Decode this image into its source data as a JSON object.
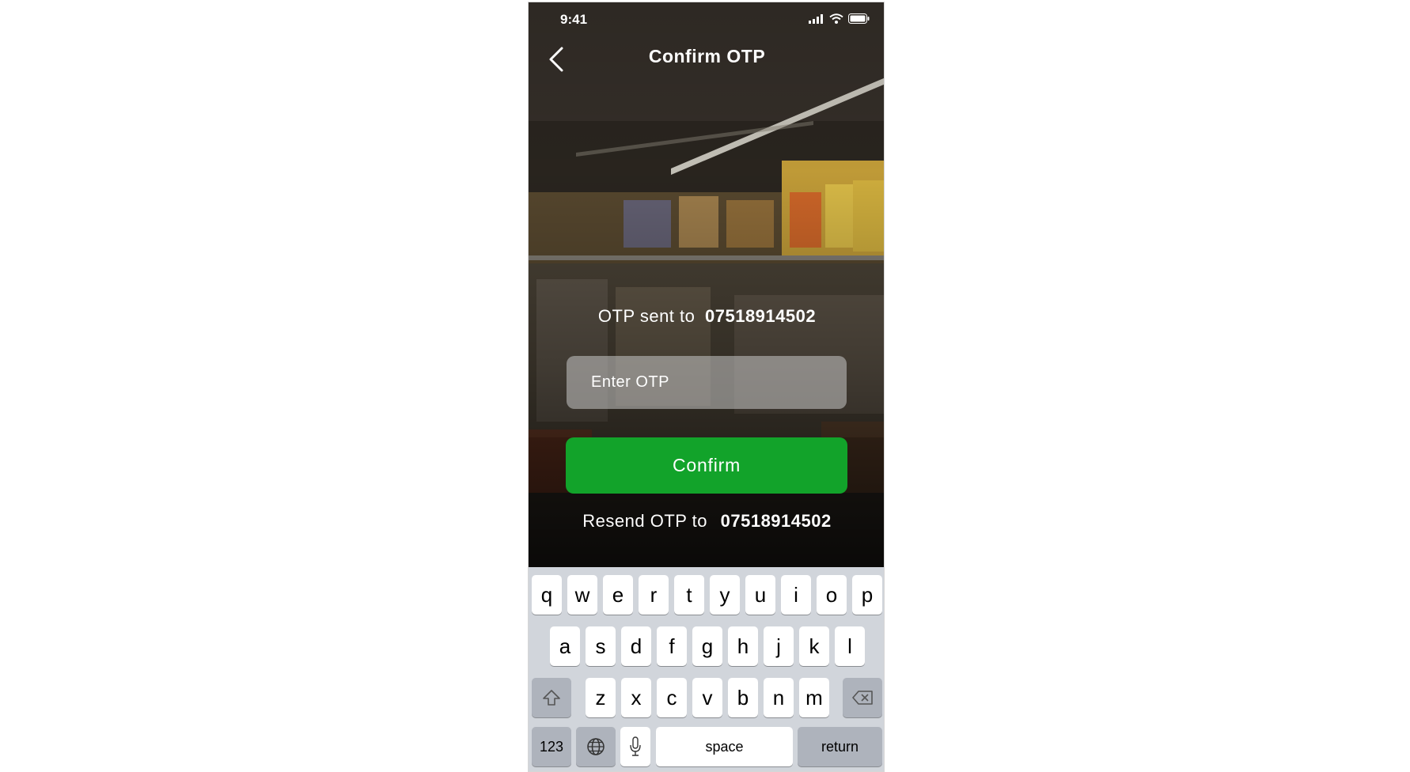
{
  "status_bar": {
    "time": "9:41"
  },
  "header": {
    "title": "Confirm OTP",
    "back_icon": "chevron-left-icon"
  },
  "otp": {
    "sent_prefix": "OTP sent to",
    "phone": "07518914502",
    "input_placeholder": "Enter OTP",
    "input_value": "",
    "confirm_label": "Confirm",
    "resend_prefix": "Resend OTP to",
    "resend_phone": "07518914502"
  },
  "colors": {
    "accent": "#12a32a",
    "keyboard_bg": "#d1d5db",
    "key": "#ffffff",
    "key_dark": "#aeb3bc"
  },
  "keyboard": {
    "row1": [
      "q",
      "w",
      "e",
      "r",
      "t",
      "y",
      "u",
      "i",
      "o",
      "p"
    ],
    "row2": [
      "a",
      "s",
      "d",
      "f",
      "g",
      "h",
      "j",
      "k",
      "l"
    ],
    "row3": [
      "z",
      "x",
      "c",
      "v",
      "b",
      "n",
      "m"
    ],
    "numbers_label": "123",
    "space_label": "space",
    "return_label": "return",
    "shift_icon": "shift-icon",
    "delete_icon": "delete-icon",
    "globe_icon": "globe-icon",
    "mic_icon": "microphone-icon"
  }
}
